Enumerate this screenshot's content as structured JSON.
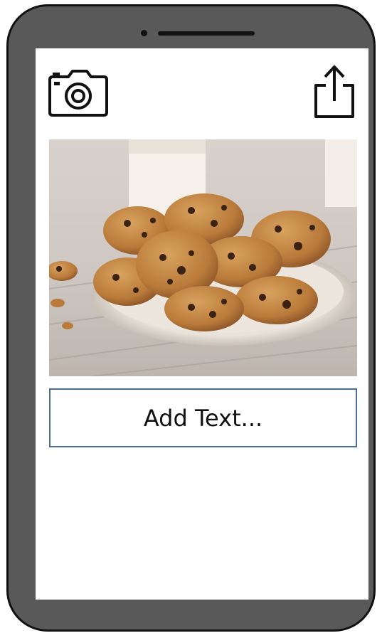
{
  "icons": {
    "camera": "camera-icon",
    "share": "share-icon"
  },
  "text_box": {
    "placeholder": "Add Text..."
  },
  "photo": {
    "subject": "chocolate-chip-cookies-photo"
  },
  "colors": {
    "phone_body": "#595959",
    "phone_outline": "#111111",
    "screen": "#ffffff",
    "text_box_border": "#4a6d96"
  }
}
